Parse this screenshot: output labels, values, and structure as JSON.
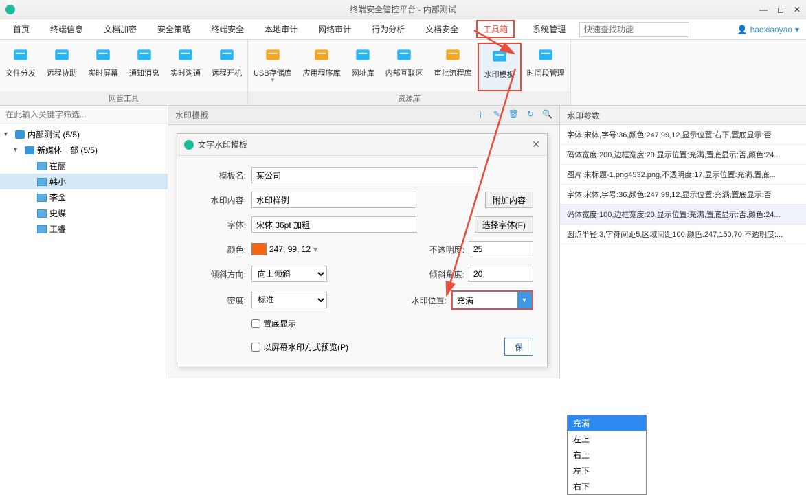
{
  "titlebar": {
    "title": "终端安全管控平台 - 内部测试"
  },
  "user": {
    "name": "haoxiaoyao"
  },
  "search": {
    "placeholder": "快速查找功能"
  },
  "menu": [
    "首页",
    "终端信息",
    "文档加密",
    "安全策略",
    "终端安全",
    "本地审计",
    "网络审计",
    "行为分析",
    "文档安全",
    "工具箱",
    "系统管理"
  ],
  "menu_active": 9,
  "ribbon": {
    "groups": [
      {
        "label": "网管工具",
        "items": [
          "文件分发",
          "远程协助",
          "实时屏幕",
          "通知消息",
          "实时沟通",
          "远程开机"
        ]
      },
      {
        "label": "资源库",
        "items": [
          "USB存储库",
          "应用程序库",
          "网址库",
          "内部互联区",
          "审批流程库",
          "水印模板",
          "时间段管理"
        ],
        "highlight": 5
      }
    ]
  },
  "filter": {
    "placeholder": "在此输入关键字筛选..."
  },
  "tree": [
    {
      "t": "▾",
      "ic": "grp",
      "lbl": "内部测试 (5/5)",
      "ind": 0
    },
    {
      "t": "▾",
      "ic": "grp",
      "lbl": "新媒体一部 (5/5)",
      "ind": 1
    },
    {
      "t": "",
      "ic": "mon",
      "lbl": "崔丽",
      "ind": 2
    },
    {
      "t": "",
      "ic": "mon",
      "lbl": "韩小",
      "ind": 2,
      "sel": true
    },
    {
      "t": "",
      "ic": "mon",
      "lbl": "李金",
      "ind": 2
    },
    {
      "t": "",
      "ic": "mon",
      "lbl": "史蝶",
      "ind": 2
    },
    {
      "t": "",
      "ic": "mon",
      "lbl": "王睿",
      "ind": 2
    }
  ],
  "tab": {
    "title": "水印模板"
  },
  "dialog": {
    "title": "文字水印模板",
    "template_name_lbl": "模板名:",
    "template_name": "某公司",
    "content_lbl": "水印内容:",
    "content": "水印样例",
    "attach_btn": "附加内容",
    "font_lbl": "字体:",
    "font": "宋体 36pt 加粗",
    "font_btn": "选择字体(F)",
    "color_lbl": "颜色:",
    "color_val": "247, 99, 12",
    "opacity_lbl": "不透明度:",
    "opacity": "25",
    "tilt_dir_lbl": "倾斜方向:",
    "tilt_dir": "向上倾斜",
    "tilt_ang_lbl": "倾斜角度:",
    "tilt_ang": "20",
    "density_lbl": "密度:",
    "density": "标准",
    "pos_lbl": "水印位置:",
    "pos": "充满",
    "bottom_chk": "置底显示",
    "preview_chk": "以屏幕水印方式预览(P)",
    "save_btn": "保"
  },
  "pos_options": [
    "充满",
    "左上",
    "右上",
    "左下",
    "右下"
  ],
  "rightpane": {
    "header": "水印参数",
    "rows": [
      "字体:宋体,字号:36,颜色:247,99,12,显示位置:右下,置底显示:否",
      "码体宽度:200,边框宽度:20,显示位置:充满,置底显示:否,颜色:24...",
      "图片:未标题-1.png4532.png,不透明度:17,显示位置:充满,置底...",
      "字体:宋体,字号:36,颜色:247,99,12,显示位置:充满,置底显示:否",
      "码体宽度:100,边框宽度:20,显示位置:充满,置底显示:否,颜色:24...",
      "圆点半径:3,字符间距5,区域间距100,颜色:247,150,70,不透明度:..."
    ],
    "hl": 4
  }
}
